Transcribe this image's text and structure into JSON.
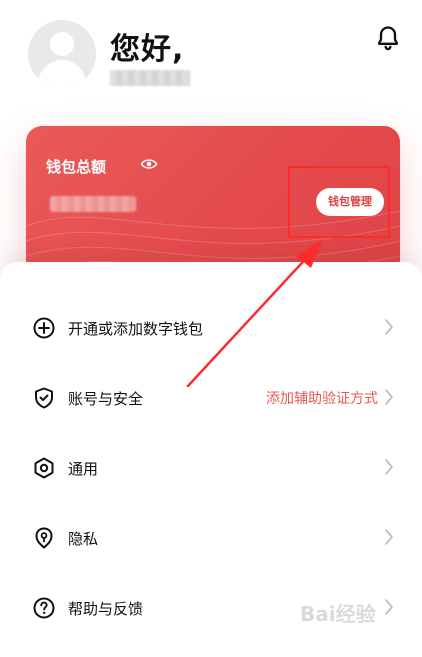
{
  "header": {
    "greeting": "您好,",
    "bell_icon": "bell-icon"
  },
  "wallet": {
    "title": "钱包总额",
    "manage_label": "钱包管理",
    "eye_icon": "eye-icon"
  },
  "menu": {
    "items": [
      {
        "label": "开通或添加数字钱包",
        "hint": "",
        "icon": "add-circle-icon"
      },
      {
        "label": "账号与安全",
        "hint": "添加辅助验证方式",
        "icon": "shield-check-icon"
      },
      {
        "label": "通用",
        "hint": "",
        "icon": "settings-hex-icon"
      },
      {
        "label": "隐私",
        "hint": "",
        "icon": "privacy-lock-icon"
      },
      {
        "label": "帮助与反馈",
        "hint": "",
        "icon": "help-circle-icon"
      }
    ]
  },
  "colors": {
    "accent_red": "#e4494c",
    "hint_red": "#e35a50",
    "highlight_box": "#ff2a2a"
  },
  "watermark": "Bai经验"
}
